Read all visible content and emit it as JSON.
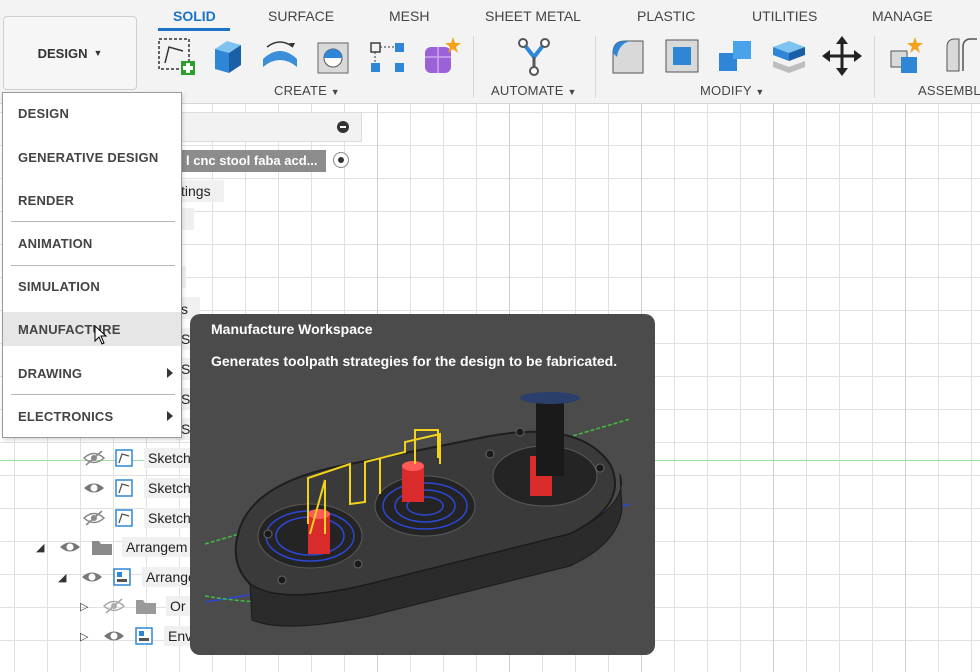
{
  "workspace_button": {
    "label": "DESIGN"
  },
  "tabs": [
    {
      "label": "SOLID",
      "active": true
    },
    {
      "label": "SURFACE"
    },
    {
      "label": "MESH"
    },
    {
      "label": "SHEET METAL"
    },
    {
      "label": "PLASTIC"
    },
    {
      "label": "UTILITIES"
    },
    {
      "label": "MANAGE"
    }
  ],
  "groups": {
    "create": "CREATE",
    "automate": "AUTOMATE",
    "modify": "MODIFY",
    "assemble": "ASSEMBL"
  },
  "browser": {
    "document_name": "l cnc stool faba acd...",
    "rows": {
      "settings": "tings",
      "s_partial": "s",
      "sketch1": "Sketch",
      "sketch2": "Sketch",
      "sketch3": "Sketch",
      "arrangements1": "Arrangem",
      "arrangements2": "Arrange",
      "origin": "Or",
      "envelope": "Env"
    },
    "hidden_sketch_labels": [
      "Sketch",
      "Sketch",
      "Sketch",
      "Sketch"
    ]
  },
  "workspace_menu": {
    "items": [
      {
        "label": "DESIGN"
      },
      {
        "label": "GENERATIVE DESIGN"
      },
      {
        "label": "RENDER"
      },
      {
        "label": "ANIMATION"
      },
      {
        "label": "SIMULATION"
      },
      {
        "label": "MANUFACTURE",
        "highlighted": true
      },
      {
        "label": "DRAWING",
        "submenu": true
      },
      {
        "label": "ELECTRONICS",
        "submenu": true
      }
    ]
  },
  "tooltip": {
    "title": "Manufacture Workspace",
    "body": "Generates toolpath strategies for the design to be fabricated."
  },
  "colors": {
    "accent": "#1a73c9",
    "tooltip_bg": "#4b4b4b",
    "menu_highlight": "#e6e6e6"
  }
}
